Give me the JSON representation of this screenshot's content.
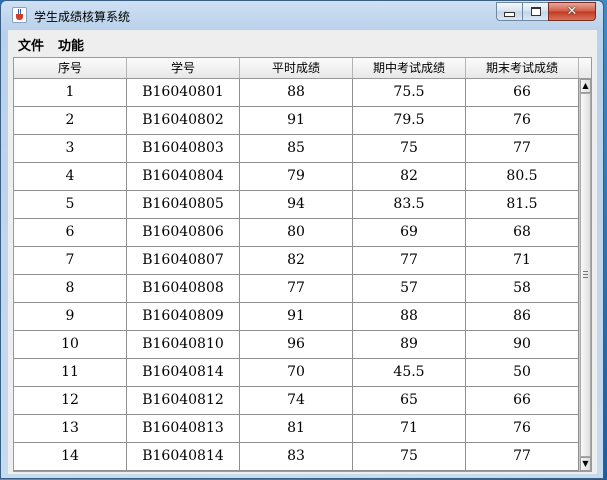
{
  "window": {
    "title": "学生成绩核算系统",
    "icon": "java-cup-icon",
    "controls": {
      "minimize_glyph": "",
      "maximize_glyph": "",
      "close_glyph": "✕"
    }
  },
  "menu": {
    "file": "文件",
    "function": "功能"
  },
  "table": {
    "columns": [
      "序号",
      "学号",
      "平时成绩",
      "期中考试成绩",
      "期末考试成绩"
    ],
    "rows": [
      [
        "1",
        "B16040801",
        "88",
        "75.5",
        "66"
      ],
      [
        "2",
        "B16040802",
        "91",
        "79.5",
        "76"
      ],
      [
        "3",
        "B16040803",
        "85",
        "75",
        "77"
      ],
      [
        "4",
        "B16040804",
        "79",
        "82",
        "80.5"
      ],
      [
        "5",
        "B16040805",
        "94",
        "83.5",
        "81.5"
      ],
      [
        "6",
        "B16040806",
        "80",
        "69",
        "68"
      ],
      [
        "7",
        "B16040807",
        "82",
        "77",
        "71"
      ],
      [
        "8",
        "B16040808",
        "77",
        "57",
        "58"
      ],
      [
        "9",
        "B16040809",
        "91",
        "88",
        "86"
      ],
      [
        "10",
        "B16040810",
        "96",
        "89",
        "90"
      ],
      [
        "11",
        "B16040814",
        "70",
        "45.5",
        "50"
      ],
      [
        "12",
        "B16040812",
        "74",
        "65",
        "66"
      ],
      [
        "13",
        "B16040813",
        "81",
        "71",
        "76"
      ],
      [
        "14",
        "B16040814",
        "83",
        "75",
        "77"
      ]
    ]
  },
  "scrollbar": {
    "up_arrow": "▲",
    "down_arrow": "▼"
  }
}
